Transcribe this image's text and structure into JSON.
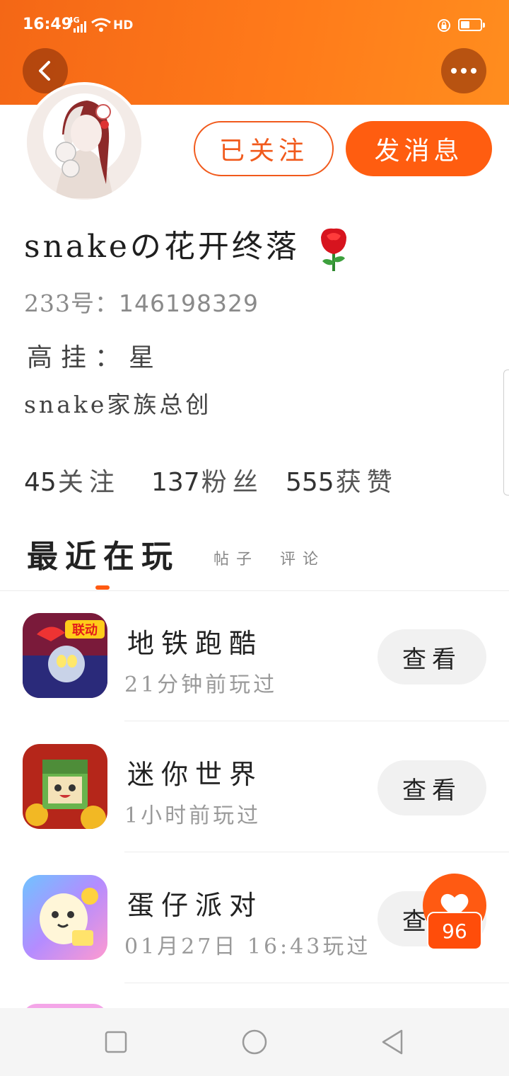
{
  "status_bar": {
    "time": "16:49",
    "signal": "4G",
    "hd": "HD"
  },
  "profile": {
    "name": "snakeの花开终落",
    "uid_label": "233号：",
    "uid_value": "146198329",
    "bio_line1": "高挂：星",
    "bio_line2": "snake家族总创",
    "follow_button": "已关注",
    "message_button": "发消息"
  },
  "stats": [
    {
      "value": "45",
      "label": "关注"
    },
    {
      "value": "137",
      "label": "粉丝"
    },
    {
      "value": "555",
      "label": "获赞"
    }
  ],
  "tabs": {
    "active": "最近在玩",
    "posts": "帖子",
    "comments": "评论"
  },
  "games": [
    {
      "title": "地铁跑酷",
      "played": "21分钟前玩过",
      "action": "查看",
      "icon_badge": "联动"
    },
    {
      "title": "迷你世界",
      "played": "1小时前玩过",
      "action": "查看"
    },
    {
      "title": "蛋仔派对",
      "played": "01月27日 16:43玩过",
      "action": "查看"
    }
  ],
  "floating": {
    "count": "96"
  },
  "colors": {
    "accent": "#ff5d10",
    "header": "#f46716"
  }
}
